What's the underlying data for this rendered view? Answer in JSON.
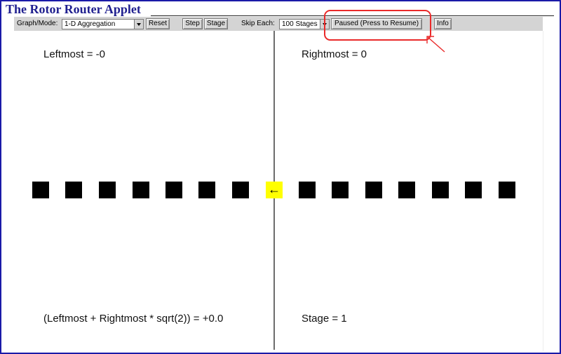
{
  "app": {
    "title": "The Rotor Router Applet"
  },
  "toolbar": {
    "graph_mode_label": "Graph/Mode:",
    "graph_mode_value": "1-D Aggregation",
    "reset_label": "Reset",
    "step_label": "Step",
    "stage_label": "Stage",
    "skip_each_label": "Skip Each:",
    "skip_each_value": "100 Stages",
    "pause_label": "Paused (Press to Resume)",
    "info_label": "Info"
  },
  "readouts": {
    "leftmost": "Leftmost = -0",
    "rightmost": "Rightmost = 0",
    "formula": "(Leftmost + Rightmost * sqrt(2)) = +0.0",
    "stage": "Stage = 1"
  },
  "rotor": {
    "arrow": "←",
    "color": "#ffff00"
  },
  "annotation": {
    "color": "#ea2a2a"
  }
}
